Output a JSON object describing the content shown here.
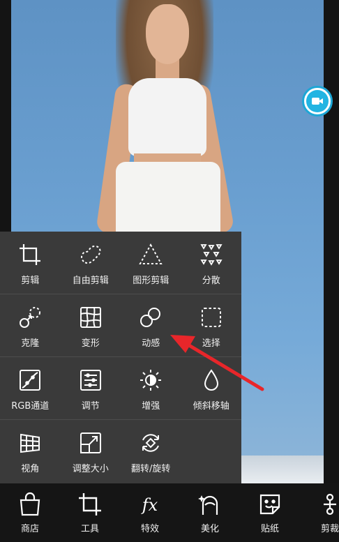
{
  "tool_menu": {
    "rows": [
      [
        {
          "label": "剪辑",
          "icon": "crop-icon"
        },
        {
          "label": "自由剪辑",
          "icon": "freeform-cut-icon"
        },
        {
          "label": "图形剪辑",
          "icon": "shape-cut-icon"
        },
        {
          "label": "分散",
          "icon": "scatter-icon"
        }
      ],
      [
        {
          "label": "克隆",
          "icon": "clone-icon"
        },
        {
          "label": "变形",
          "icon": "warp-icon"
        },
        {
          "label": "动感",
          "icon": "motion-icon"
        },
        {
          "label": "选择",
          "icon": "select-icon"
        }
      ],
      [
        {
          "label": "RGB通道",
          "icon": "rgb-curve-icon"
        },
        {
          "label": "调节",
          "icon": "adjust-icon"
        },
        {
          "label": "增强",
          "icon": "enhance-icon"
        },
        {
          "label": "倾斜移轴",
          "icon": "tilt-shift-icon"
        }
      ],
      [
        {
          "label": "视角",
          "icon": "perspective-icon"
        },
        {
          "label": "调整大小",
          "icon": "resize-icon"
        },
        {
          "label": "翻转/旋转",
          "icon": "flip-rotate-icon"
        }
      ]
    ]
  },
  "bottom_nav": {
    "items": [
      {
        "label": "商店",
        "icon": "shop-bag-icon"
      },
      {
        "label": "工具",
        "icon": "crop-tool-icon"
      },
      {
        "label": "特效",
        "icon": "fx-icon"
      },
      {
        "label": "美化",
        "icon": "beautify-icon"
      },
      {
        "label": "贴纸",
        "icon": "sticker-icon"
      },
      {
        "label": "剪裁",
        "icon": "cutout-icon"
      }
    ]
  },
  "colors": {
    "panel_bg": "#3a3a3a",
    "nav_bg": "#151515",
    "accent_cyan": "#21b4e2",
    "annotation_red": "#e8262a",
    "photo_bg": "#6a9fd0"
  }
}
